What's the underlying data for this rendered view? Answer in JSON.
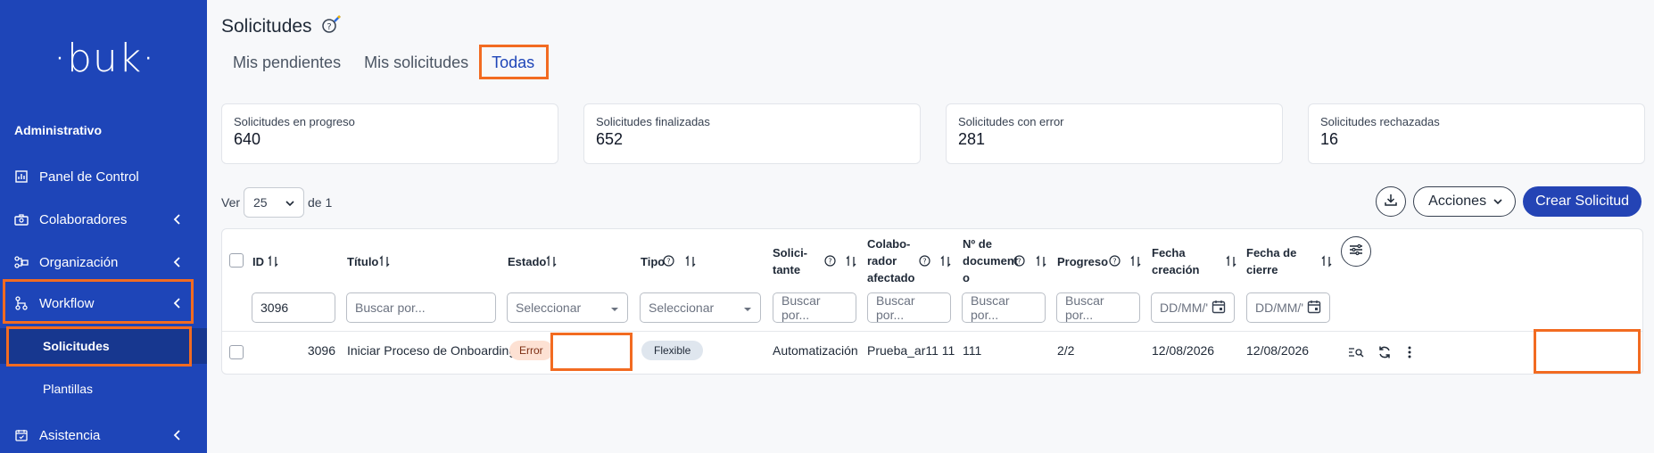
{
  "brand": {
    "logo": "·buk·",
    "sidebar_color": "#1e45b8",
    "accent": "#f26b21"
  },
  "sidebar": {
    "section": "Administrativo",
    "items": [
      {
        "label": "Panel de Control",
        "icon": "chart-icon"
      },
      {
        "label": "Colaboradores",
        "icon": "people-icon"
      },
      {
        "label": "Organización",
        "icon": "org-icon"
      },
      {
        "label": "Workflow",
        "icon": "workflow-icon"
      },
      {
        "label": "Asistencia",
        "icon": "calendar-icon"
      }
    ],
    "subitems": [
      {
        "label": "Solicitudes"
      },
      {
        "label": "Plantillas"
      }
    ]
  },
  "page": {
    "title": "Solicitudes"
  },
  "tabs": [
    {
      "label": "Mis pendientes"
    },
    {
      "label": "Mis solicitudes"
    },
    {
      "label": "Todas"
    }
  ],
  "cards": [
    {
      "title": "Solicitudes en progreso",
      "value": "640"
    },
    {
      "title": "Solicitudes finalizadas",
      "value": "652"
    },
    {
      "title": "Solicitudes con error",
      "value": "281"
    },
    {
      "title": "Solicitudes rechazadas",
      "value": "16"
    }
  ],
  "pagination": {
    "ver": "Ver",
    "per_page": "25",
    "of": "de 1"
  },
  "toolbar": {
    "acciones": "Acciones",
    "crear": "Crear Solicitud"
  },
  "table": {
    "headers": {
      "id": "ID",
      "titulo": "Título",
      "estado": "Estado",
      "tipo": "Tipo",
      "solicitante_1": "Solici-",
      "solicitante_2": "tante",
      "colaborador_1": "Colabo-",
      "colaborador_2": "rador",
      "colaborador_3": "afectado",
      "documento_1": "Nº de",
      "documento_2": "document",
      "documento_3": "o",
      "progreso": "Progreso",
      "fecha_creacion_1": "Fecha",
      "fecha_creacion_2": "creación",
      "fecha_cierre_1": "Fecha de",
      "fecha_cierre_2": "cierre"
    },
    "filters": {
      "id": "3096",
      "buscar": "Buscar por...",
      "seleccionar": "Seleccionar",
      "fecha": "DD/MM/'"
    },
    "rows": [
      {
        "id": "3096",
        "titulo": "Iniciar Proceso de Onboarding",
        "estado": "Error",
        "tipo": "Flexible",
        "solicitante": "Automatización",
        "colaborador": "Prueba_ar11 11",
        "documento": "111",
        "progreso": "2/2",
        "fecha_creacion": "12/08/2026",
        "fecha_cierre": "12/08/2026"
      }
    ]
  }
}
